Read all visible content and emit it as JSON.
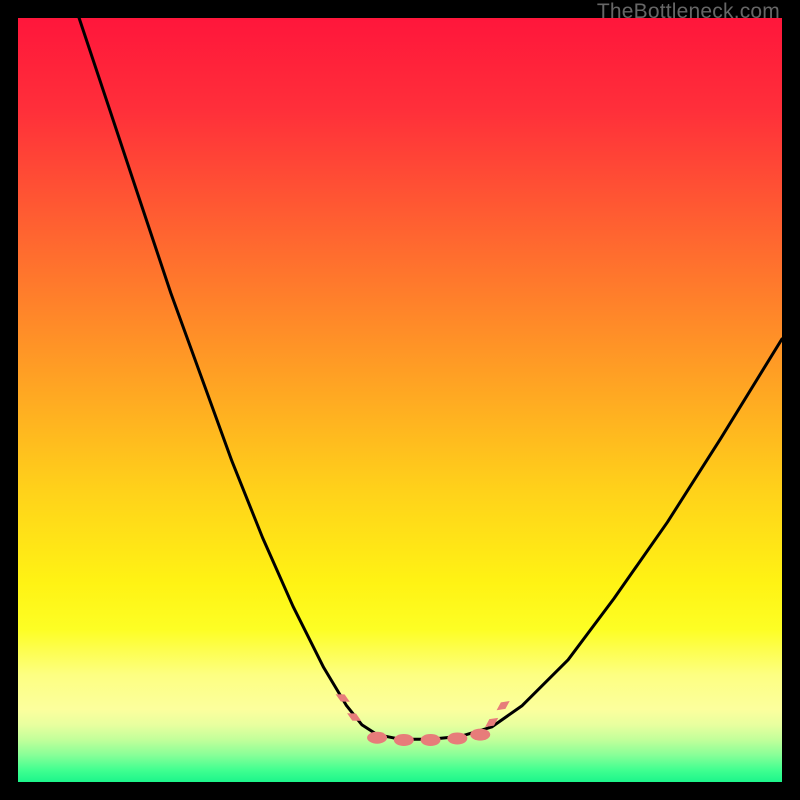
{
  "watermark": "TheBottleneck.com",
  "chart_data": {
    "type": "line",
    "title": "",
    "xlabel": "",
    "ylabel": "",
    "xlim": [
      0,
      100
    ],
    "ylim": [
      0,
      100
    ],
    "grid": false,
    "legend": false,
    "background_gradient": {
      "stops": [
        {
          "offset": 0.0,
          "color": "#ff163b"
        },
        {
          "offset": 0.12,
          "color": "#ff2f3a"
        },
        {
          "offset": 0.3,
          "color": "#ff6a2f"
        },
        {
          "offset": 0.48,
          "color": "#ffa423"
        },
        {
          "offset": 0.62,
          "color": "#ffd21a"
        },
        {
          "offset": 0.74,
          "color": "#fff314"
        },
        {
          "offset": 0.8,
          "color": "#fdfe24"
        },
        {
          "offset": 0.86,
          "color": "#fdff82"
        },
        {
          "offset": 0.905,
          "color": "#fcff9d"
        },
        {
          "offset": 0.925,
          "color": "#e8ff9f"
        },
        {
          "offset": 0.945,
          "color": "#c1ff9a"
        },
        {
          "offset": 0.965,
          "color": "#87ff98"
        },
        {
          "offset": 0.985,
          "color": "#3fff90"
        },
        {
          "offset": 1.0,
          "color": "#1cf58b"
        }
      ]
    },
    "series": [
      {
        "name": "left-curve",
        "style": "black-line",
        "x": [
          8,
          12,
          16,
          20,
          24,
          28,
          32,
          36,
          40,
          43,
          45
        ],
        "y": [
          100,
          88,
          76,
          64,
          53,
          42,
          32,
          23,
          15,
          10,
          7.5
        ]
      },
      {
        "name": "valley-floor",
        "style": "black-line",
        "x": [
          45,
          47,
          50,
          54,
          58,
          62
        ],
        "y": [
          7.5,
          6.2,
          5.6,
          5.6,
          6.0,
          7.2
        ]
      },
      {
        "name": "right-curve",
        "style": "black-line",
        "x": [
          62,
          66,
          72,
          78,
          85,
          92,
          100
        ],
        "y": [
          7.2,
          10,
          16,
          24,
          34,
          45,
          58
        ]
      }
    ],
    "markers": [
      {
        "name": "left-tick-upper",
        "x": 42.5,
        "y": 11,
        "shape": "diamond",
        "color": "#e77c7a"
      },
      {
        "name": "left-tick-lower",
        "x": 44.0,
        "y": 8.5,
        "shape": "diamond",
        "color": "#e77c7a"
      },
      {
        "name": "right-tick-upper",
        "x": 63.5,
        "y": 10,
        "shape": "diamond",
        "color": "#e77c7a"
      },
      {
        "name": "right-tick-lower",
        "x": 62.0,
        "y": 7.8,
        "shape": "diamond",
        "color": "#e77c7a"
      },
      {
        "name": "floor-bead-1",
        "x": 47.0,
        "y": 5.8,
        "shape": "bead",
        "color": "#e77c7a"
      },
      {
        "name": "floor-bead-2",
        "x": 50.5,
        "y": 5.5,
        "shape": "bead",
        "color": "#e77c7a"
      },
      {
        "name": "floor-bead-3",
        "x": 54.0,
        "y": 5.5,
        "shape": "bead",
        "color": "#e77c7a"
      },
      {
        "name": "floor-bead-4",
        "x": 57.5,
        "y": 5.7,
        "shape": "bead",
        "color": "#e77c7a"
      },
      {
        "name": "floor-bead-5",
        "x": 60.5,
        "y": 6.2,
        "shape": "bead",
        "color": "#e77c7a"
      }
    ]
  }
}
